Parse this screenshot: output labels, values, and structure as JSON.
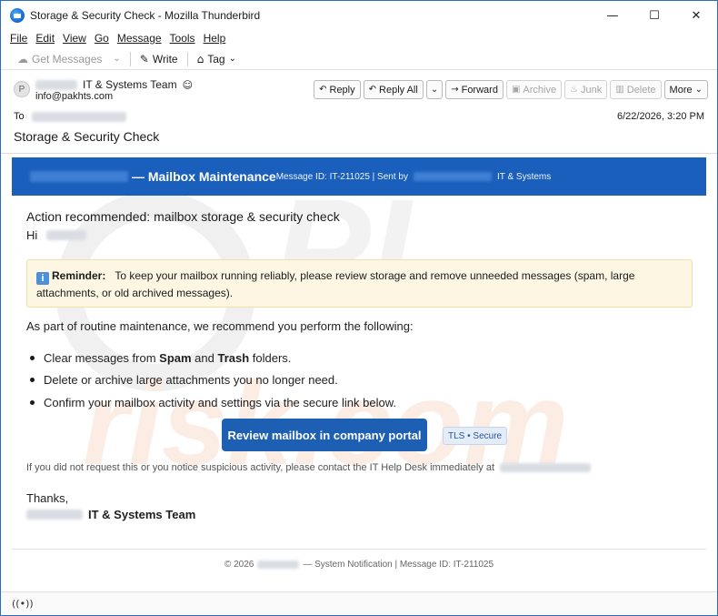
{
  "window": {
    "title": "Storage & Security Check - Mozilla Thunderbird",
    "controls": [
      "—",
      "☐",
      "✕"
    ]
  },
  "menu": [
    "File",
    "Edit",
    "View",
    "Go",
    "Message",
    "Tools",
    "Help"
  ],
  "toolbar": {
    "get_messages": "Get Messages",
    "write": "Write",
    "tag": "Tag"
  },
  "header": {
    "avatar_letter": "P",
    "from_name": "IT & Systems Team",
    "from_email": "info@pakhts.com",
    "to_label": "To",
    "date": "6/22/2026, 3:20 PM",
    "subject": "Storage & Security Check",
    "buttons": {
      "reply": "Reply",
      "reply_all": "Reply All",
      "forward": "Forward",
      "archive": "Archive",
      "junk": "Junk",
      "delete": "Delete",
      "more": "More"
    }
  },
  "banner": {
    "title": "— Mailbox Maintenance",
    "meta": "Message ID: IT-211025 | Sent by",
    "team": "IT & Systems"
  },
  "email": {
    "action": "Action recommended: mailbox storage & security check",
    "greeting": "Hi",
    "reminder_label": "Reminder:",
    "reminder_text": "To keep your mailbox running reliably, please review storage and remove unneeded messages (spam, large attachments, or old archived messages).",
    "intro": "As part of routine maintenance, we recommend you perform the following:",
    "bullet1_pre": "Clear messages from ",
    "bullet1_spam": "Spam",
    "bullet1_and": " and ",
    "bullet1_trash": "Trash",
    "bullet1_post": " folders.",
    "bullet2": "Delete or archive large attachments you no longer need.",
    "bullet3": "Confirm your mailbox activity and settings via the secure link below.",
    "cta": "Review mailbox in company portal",
    "tls": "TLS • Secure",
    "note": "If you did not request this or you notice suspicious activity, please contact the IT Help Desk immediately at",
    "thanks": "Thanks,",
    "signature": "IT & Systems Team",
    "footer_pre": "© 2026",
    "footer_post": "— System Notification | Message ID: IT-211025"
  },
  "colors": {
    "banner": "#1a5fbb",
    "cta": "#1d5fb2",
    "reminder_bg": "#fdf6e3"
  }
}
